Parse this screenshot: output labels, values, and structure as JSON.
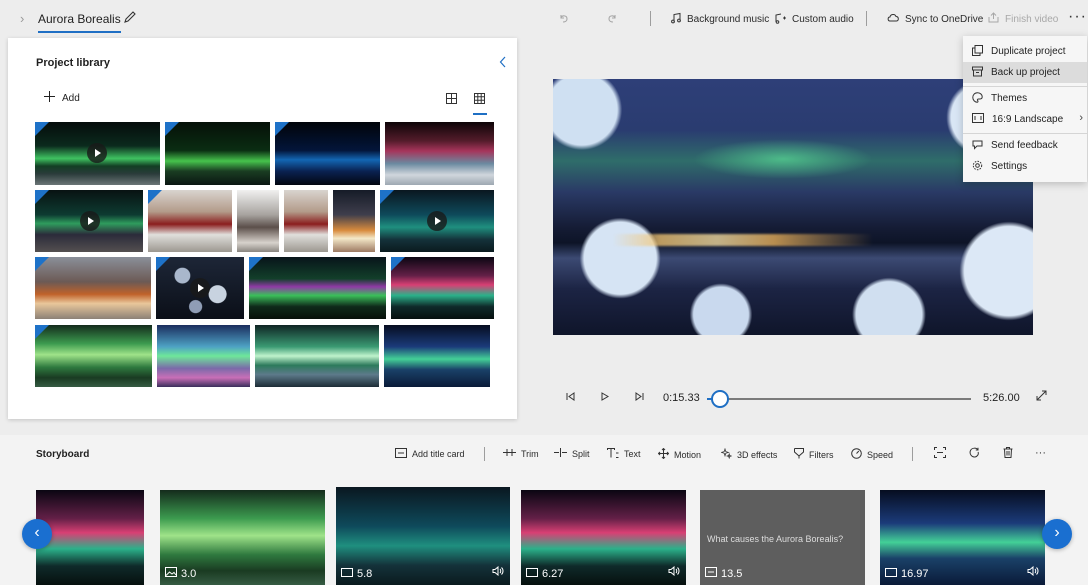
{
  "topbar": {
    "project_title": "Aurora Borealis",
    "background_music": "Background music",
    "custom_audio": "Custom audio",
    "sync_onedrive": "Sync to OneDrive",
    "finish_video": "Finish video",
    "more": "···"
  },
  "library": {
    "title": "Project library",
    "add_label": "Add"
  },
  "playback": {
    "current_time": "0:15.33",
    "total_time": "5:26.00",
    "progress": 0.05
  },
  "menu": {
    "items": [
      {
        "label": "Duplicate project",
        "icon": "duplicate-icon"
      },
      {
        "label": "Back up project",
        "icon": "backup-icon"
      },
      {
        "label": "Themes",
        "icon": "palette-icon"
      },
      {
        "label": "16:9 Landscape",
        "icon": "aspect-ratio-icon"
      },
      {
        "label": "Send feedback",
        "icon": "feedback-icon"
      },
      {
        "label": "Settings",
        "icon": "gear-icon"
      }
    ]
  },
  "storyboard": {
    "title": "Storyboard",
    "add_title_card": "Add title card",
    "trim": "Trim",
    "split": "Split",
    "text": "Text",
    "motion": "Motion",
    "effects_3d": "3D effects",
    "filters": "Filters",
    "speed": "Speed",
    "more": "···",
    "clips": [
      {
        "duration": ""
      },
      {
        "duration": "3.0",
        "icon": "image-icon"
      },
      {
        "duration": "5.8",
        "icon": "video-icon",
        "audio": true
      },
      {
        "duration": "6.27",
        "icon": "video-icon",
        "audio": true
      },
      {
        "duration": "13.5",
        "icon": "title-card-icon",
        "caption": "What causes the Aurora Borealis?"
      },
      {
        "duration": "16.97",
        "icon": "video-icon",
        "audio": true
      }
    ]
  },
  "colors": {
    "accent": "#1f6fc4",
    "nav_button": "#1a6fd0"
  }
}
